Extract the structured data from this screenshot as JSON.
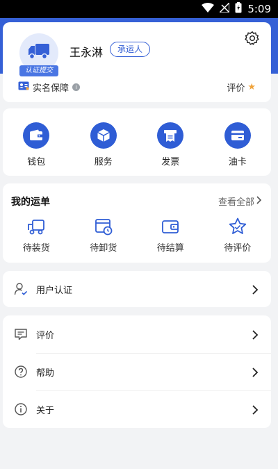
{
  "status_bar": {
    "time": "5:09",
    "wifi_icon": "wifi-icon",
    "signal_icon": "no-signal-icon",
    "battery_icon": "battery-charging-icon"
  },
  "profile": {
    "name": "王永淋",
    "role": "承运人",
    "avatar_icon": "truck-icon",
    "cert_tag": "认证提交",
    "realname_label": "实名保障",
    "rating_label": "评价",
    "settings_icon": "gear-icon",
    "accent_color": "#3560d6",
    "star_color": "#f0a33b"
  },
  "quick_actions": [
    {
      "label": "钱包",
      "icon": "wallet-icon"
    },
    {
      "label": "服务",
      "icon": "box-icon"
    },
    {
      "label": "发票",
      "icon": "invoice-icon"
    },
    {
      "label": "油卡",
      "icon": "card-icon"
    }
  ],
  "orders": {
    "title": "我的运单",
    "view_all": "查看全部",
    "items": [
      {
        "label": "待装货",
        "icon": "truck-load-icon"
      },
      {
        "label": "待卸货",
        "icon": "clock-box-icon"
      },
      {
        "label": "待结算",
        "icon": "wallet-outline-icon"
      },
      {
        "label": "待评价",
        "icon": "star-outline-icon"
      }
    ]
  },
  "auth": {
    "label": "用户认证",
    "icon": "user-check-icon"
  },
  "menu": [
    {
      "label": "评价",
      "icon": "comment-icon"
    },
    {
      "label": "帮助",
      "icon": "help-icon"
    },
    {
      "label": "关于",
      "icon": "info-icon"
    }
  ]
}
